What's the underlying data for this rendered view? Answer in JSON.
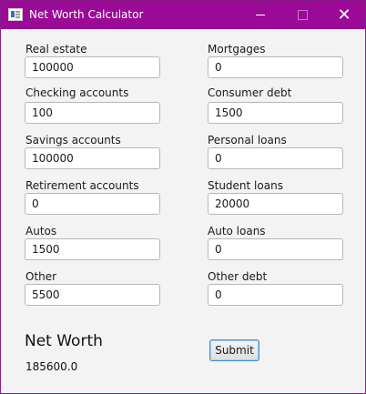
{
  "window": {
    "title": "Net Worth Calculator",
    "minimize_icon": "minimize-icon",
    "maximize_icon": "maximize-icon",
    "close_icon": "close-icon",
    "close_glyph": "✕"
  },
  "assets": [
    {
      "label": "Real estate",
      "value": "100000"
    },
    {
      "label": "Checking accounts",
      "value": "100"
    },
    {
      "label": "Savings accounts",
      "value": "100000"
    },
    {
      "label": "Retirement accounts",
      "value": "0"
    },
    {
      "label": "Autos",
      "value": "1500"
    },
    {
      "label": "Other",
      "value": "5500"
    }
  ],
  "liabilities": [
    {
      "label": "Mortgages",
      "value": "0"
    },
    {
      "label": "Consumer debt",
      "value": "1500"
    },
    {
      "label": "Personal loans",
      "value": "0"
    },
    {
      "label": "Student loans",
      "value": "20000"
    },
    {
      "label": "Auto loans",
      "value": "0"
    },
    {
      "label": "Other debt",
      "value": "0"
    }
  ],
  "result": {
    "title": "Net Worth",
    "value": "185600.0"
  },
  "submit_label": "Submit",
  "colors": {
    "titlebar": "#9b0a96",
    "window_bg": "#f3f3f3",
    "focus_border": "#3c8dd6"
  }
}
